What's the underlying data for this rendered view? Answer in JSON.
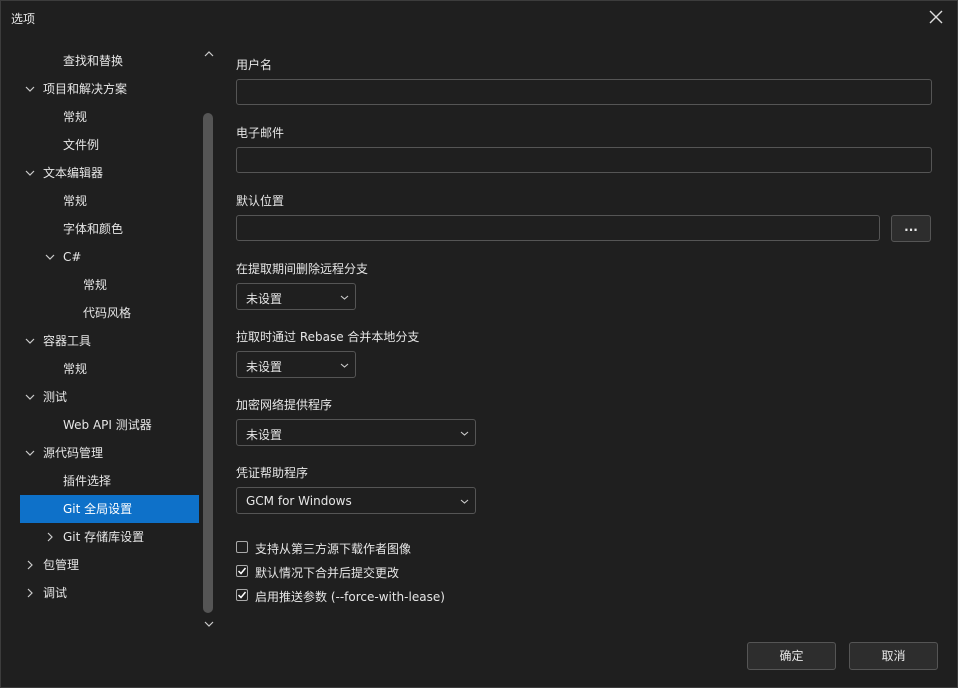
{
  "window": {
    "title": "选项"
  },
  "tree": {
    "items": [
      {
        "label": "查找和替换",
        "expander": "none"
      },
      {
        "label": "项目和解决方案",
        "expander": "expanded"
      },
      {
        "label": "常规",
        "expander": "none"
      },
      {
        "label": "文件例",
        "expander": "none"
      },
      {
        "label": "文本编辑器",
        "expander": "expanded"
      },
      {
        "label": "常规",
        "expander": "none"
      },
      {
        "label": "字体和颜色",
        "expander": "none"
      },
      {
        "label": "C#",
        "expander": "expanded"
      },
      {
        "label": "常规",
        "expander": "none"
      },
      {
        "label": "代码风格",
        "expander": "none"
      },
      {
        "label": "容器工具",
        "expander": "expanded"
      },
      {
        "label": "常规",
        "expander": "none"
      },
      {
        "label": "测试",
        "expander": "expanded"
      },
      {
        "label": "Web API 测试器",
        "expander": "none"
      },
      {
        "label": "源代码管理",
        "expander": "expanded"
      },
      {
        "label": "插件选择",
        "expander": "none"
      },
      {
        "label": "Git 全局设置",
        "expander": "none",
        "selected": true
      },
      {
        "label": "Git 存储库设置",
        "expander": "collapsed"
      },
      {
        "label": "包管理",
        "expander": "collapsed"
      },
      {
        "label": "调试",
        "expander": "collapsed"
      }
    ]
  },
  "form": {
    "username_label": "用户名",
    "username_value": "",
    "email_label": "电子邮件",
    "email_value": "",
    "default_location_label": "默认位置",
    "default_location_value": "",
    "browse_label": "...",
    "prune_label": "在提取期间删除远程分支",
    "prune_value": "未设置",
    "rebase_label": "拉取时通过 Rebase 合并本地分支",
    "rebase_value": "未设置",
    "crypto_label": "加密网络提供程序",
    "crypto_value": "未设置",
    "credential_label": "凭证帮助程序",
    "credential_value": "GCM for Windows",
    "checks": [
      {
        "label": "支持从第三方源下载作者图像",
        "checked": false
      },
      {
        "label": "默认情况下合并后提交更改",
        "checked": true
      },
      {
        "label": "启用推送参数 (--force-with-lease)",
        "checked": true
      }
    ]
  },
  "buttons": {
    "ok": "确定",
    "cancel": "取消"
  },
  "colors": {
    "accent": "#0e71c9",
    "background": "#1f1f1f",
    "border": "#555555"
  }
}
